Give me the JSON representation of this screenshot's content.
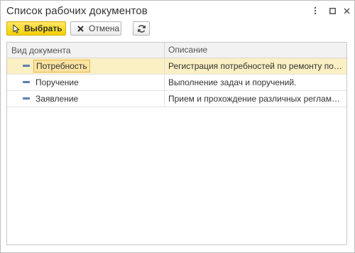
{
  "window": {
    "title": "Список рабочих документов"
  },
  "toolbar": {
    "select_label": "Выбрать",
    "cancel_label": "Отмена"
  },
  "table": {
    "columns": [
      "Вид документа",
      "Описание"
    ],
    "rows": [
      {
        "name": "Потребность",
        "description": "Регистрация потребностей по ремонту помещений",
        "selected": true
      },
      {
        "name": "Поручение",
        "description": "Выполнение задач и поручений.",
        "selected": false
      },
      {
        "name": "Заявление",
        "description": "Прием и прохождение различных регламентных заявлений",
        "selected": false
      }
    ]
  },
  "colors": {
    "accent_button": "#f5d000",
    "selected_row": "#fbefc4",
    "row_icon": "#6f90c4"
  },
  "icons": {
    "menu": "more-vertical-icon",
    "maximize": "maximize-icon",
    "close": "close-icon",
    "select": "cursor-arrow-icon",
    "cancel": "x-icon",
    "refresh": "refresh-icon",
    "row": "document-type-icon"
  }
}
